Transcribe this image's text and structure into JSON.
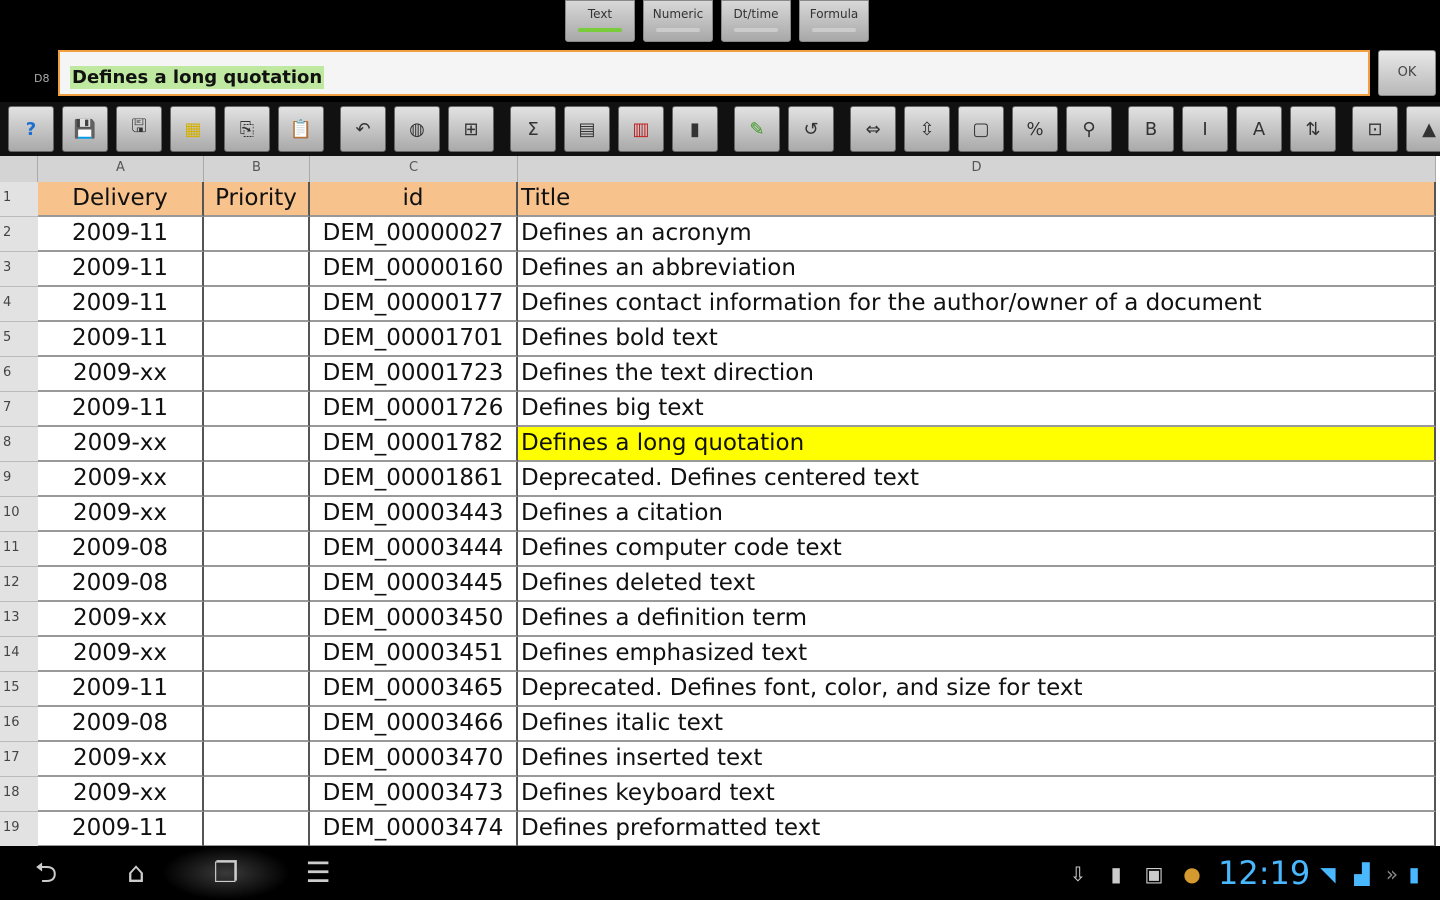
{
  "mode_tabs": [
    {
      "label": "Text",
      "active": true
    },
    {
      "label": "Numeric",
      "active": false
    },
    {
      "label": "Dt/time",
      "active": false
    },
    {
      "label": "Formula",
      "active": false
    }
  ],
  "edit": {
    "cell_ref": "D8",
    "value": "Defines a long quotation",
    "ok_label": "OK"
  },
  "toolbar_icons": [
    "help-icon",
    "save-icon",
    "save-as-icon",
    "grid-icon",
    "copy-icon",
    "paste-icon",
    "undo-curve-icon",
    "globe-icon",
    "cells-icon",
    "sum-icon",
    "chart-icon",
    "calendar-grid-icon",
    "bar-chart-icon",
    "pen-icon",
    "undo-icon",
    "insert-row-icon",
    "resize-icon",
    "date-icon",
    "number-format-icon",
    "search-icon",
    "bold-icon",
    "italic-icon",
    "text-color-icon",
    "sort-icon",
    "border-icon",
    "fill-icon"
  ],
  "columns": [
    {
      "letter": "A"
    },
    {
      "letter": "B"
    },
    {
      "letter": "C"
    },
    {
      "letter": "D"
    }
  ],
  "header_row": {
    "num": "1",
    "a": "Delivery",
    "b": "Priority",
    "c": "id",
    "d": "Title"
  },
  "rows": [
    {
      "num": "2",
      "a": "2009-11",
      "b": "",
      "c": "DEM_00000027",
      "d": "Defines an acronym"
    },
    {
      "num": "3",
      "a": "2009-11",
      "b": "",
      "c": "DEM_00000160",
      "d": "Defines an abbreviation"
    },
    {
      "num": "4",
      "a": "2009-11",
      "b": "",
      "c": "DEM_00000177",
      "d": "Defines contact information for the author/owner of a document"
    },
    {
      "num": "5",
      "a": "2009-11",
      "b": "",
      "c": "DEM_00001701",
      "d": "Defines bold text"
    },
    {
      "num": "6",
      "a": "2009-xx",
      "b": "",
      "c": "DEM_00001723",
      "d": "Defines the text direction"
    },
    {
      "num": "7",
      "a": "2009-11",
      "b": "",
      "c": "DEM_00001726",
      "d": "Defines big text"
    },
    {
      "num": "8",
      "a": "2009-xx",
      "b": "",
      "c": "DEM_00001782",
      "d": "Defines a long quotation"
    },
    {
      "num": "9",
      "a": "2009-xx",
      "b": "",
      "c": "DEM_00001861",
      "d": "Deprecated. Defines centered text"
    },
    {
      "num": "10",
      "a": "2009-xx",
      "b": "",
      "c": "DEM_00003443",
      "d": "Defines a citation"
    },
    {
      "num": "11",
      "a": "2009-08",
      "b": "",
      "c": "DEM_00003444",
      "d": "Defines computer code text"
    },
    {
      "num": "12",
      "a": "2009-08",
      "b": "",
      "c": "DEM_00003445",
      "d": "Defines deleted text"
    },
    {
      "num": "13",
      "a": "2009-xx",
      "b": "",
      "c": "DEM_00003450",
      "d": "Defines a definition term"
    },
    {
      "num": "14",
      "a": "2009-xx",
      "b": "",
      "c": "DEM_00003451",
      "d": "Defines emphasized text"
    },
    {
      "num": "15",
      "a": "2009-11",
      "b": "",
      "c": "DEM_00003465",
      "d": "Deprecated. Defines font, color, and size for text"
    },
    {
      "num": "16",
      "a": "2009-08",
      "b": "",
      "c": "DEM_00003466",
      "d": "Defines italic text"
    },
    {
      "num": "17",
      "a": "2009-xx",
      "b": "",
      "c": "DEM_00003470",
      "d": "Defines inserted text"
    },
    {
      "num": "18",
      "a": "2009-xx",
      "b": "",
      "c": "DEM_00003473",
      "d": "Defines keyboard text"
    },
    {
      "num": "19",
      "a": "2009-11",
      "b": "",
      "c": "DEM_00003474",
      "d": "Defines preformatted text"
    }
  ],
  "selected_row": "8",
  "colors": {
    "header_fill": "#f8c28c",
    "selection": "#ffff00",
    "clock": "#4ab8ff",
    "edit_border": "#f0a040"
  },
  "status": {
    "time": "12:19"
  }
}
